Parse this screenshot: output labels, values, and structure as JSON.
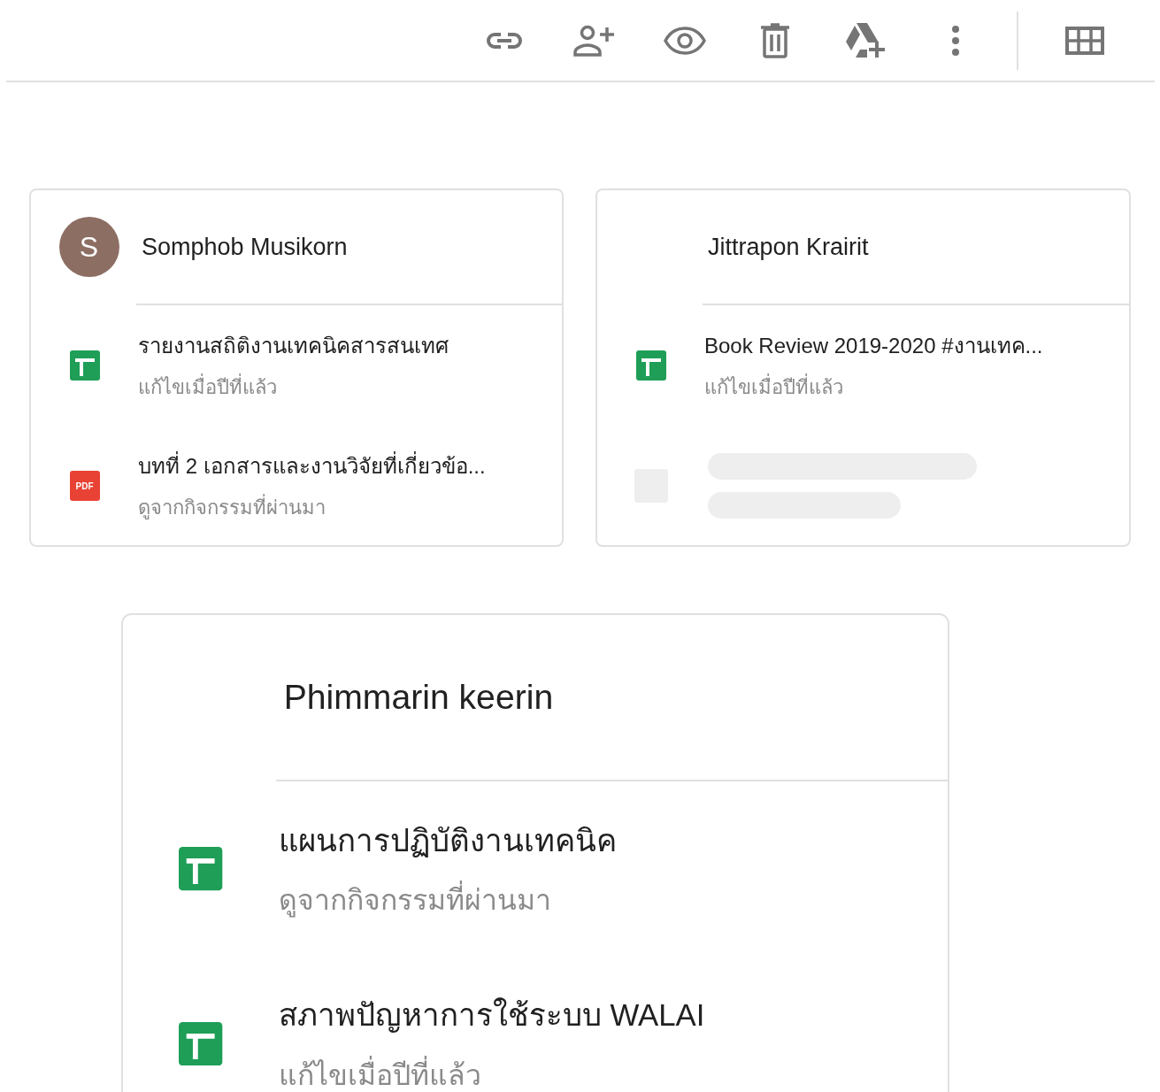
{
  "toolbar": {
    "actions": [
      {
        "kind": "link"
      },
      {
        "kind": "share"
      },
      {
        "kind": "preview"
      },
      {
        "kind": "delete"
      },
      {
        "kind": "drive-add"
      },
      {
        "kind": "more"
      },
      {
        "kind": "grid"
      }
    ]
  },
  "cards": [
    {
      "person": "Somphob Musikorn",
      "avatar": {
        "letter": "S"
      },
      "files": [
        {
          "kind": "sheet",
          "title": "รายงานสถิติงานเทคนิคสารสนเทศ",
          "subtitle": "แก้ไขเมื่อปีที่แล้ว"
        },
        {
          "kind": "pdf",
          "badge": "PDF",
          "title": "บทที่ 2 เอกสารและงานวิจัยที่เกี่ยวข้อ...",
          "subtitle": "ดูจากกิจกรรมที่ผ่านมา"
        }
      ]
    },
    {
      "person": "Jittrapon Krairit",
      "files": [
        {
          "kind": "sheet",
          "title": "Book Review 2019-2020 #งานเทค...",
          "subtitle": "แก้ไขเมื่อปีที่แล้ว"
        },
        {
          "kind": "loading"
        }
      ]
    },
    {
      "person": "Phimmarin keerin",
      "files": [
        {
          "kind": "sheet",
          "title": "แผนการปฏิบัติงานเทคนิค",
          "subtitle": "ดูจากกิจกรรมที่ผ่านมา"
        },
        {
          "kind": "sheet",
          "title": "สภาพปัญหาการใช้ระบบ WALAI",
          "subtitle": "แก้ไขเมื่อปีที่แล้ว"
        }
      ]
    }
  ]
}
